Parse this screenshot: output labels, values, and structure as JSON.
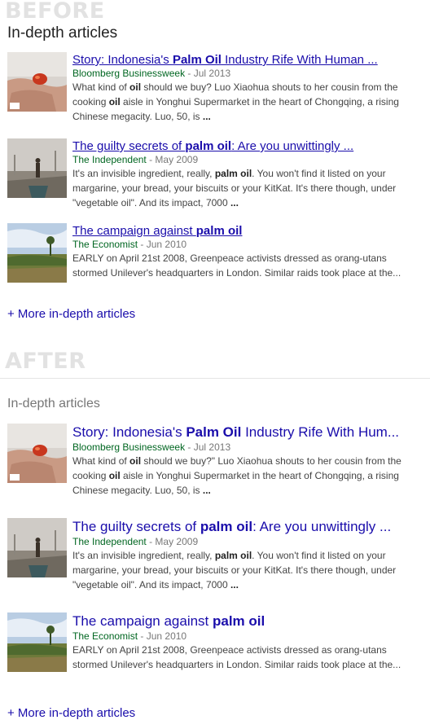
{
  "before": {
    "banner": "BEFORE",
    "header": "In-depth articles",
    "more_link": "+ More in-depth articles"
  },
  "after": {
    "banner": "AFTER",
    "header": "In-depth articles",
    "more_link": "+ More in-depth articles"
  },
  "articles": [
    {
      "title_pre": "Story: Indonesia's ",
      "title_bold": "Palm Oil",
      "title_post": " Industry Rife With Human ...",
      "title_post_after": " Industry Rife With Hum...",
      "source": "Bloomberg Businessweek",
      "date": " - Jul 2013",
      "snippet": [
        {
          "t": "What kind of "
        },
        {
          "t": "oil",
          "b": true
        },
        {
          "t": " should we buy? Luo Xiaohua shouts to her cousin from the cooking "
        },
        {
          "t": "oil",
          "b": true
        },
        {
          "t": " aisle in Yonghui Supermarket in the heart of Chongqing, a rising Chinese megacity. Luo, 50, is "
        },
        {
          "t": "...",
          "b": true
        }
      ],
      "snippet_after": [
        {
          "t": "What kind of "
        },
        {
          "t": "oil",
          "b": true
        },
        {
          "t": " should we buy?\" Luo Xiaohua shouts to her cousin from the cooking "
        },
        {
          "t": "oil",
          "b": true
        },
        {
          "t": " aisle in Yonghui Supermarket in the heart of Chongqing, a rising Chinese megacity. Luo, 50, is "
        },
        {
          "t": "...",
          "b": true
        }
      ],
      "thumb_icon": "hand-holding-palm-fruit-thumbnail"
    },
    {
      "title_pre": "The guilty secrets of ",
      "title_bold": "palm oil",
      "title_post": ": Are you unwittingly ...",
      "title_post_after": ": Are you unwittingly ...",
      "source": "The Independent",
      "date": " - May 2009",
      "snippet": [
        {
          "t": "It's an invisible ingredient, really, "
        },
        {
          "t": "palm oil",
          "b": true
        },
        {
          "t": ". You won't find it listed on your margarine, your bread, your biscuits or your KitKat. It's there though, under \"vegetable oil\". And its impact, 7000 "
        },
        {
          "t": "...",
          "b": true
        }
      ],
      "snippet_after": [
        {
          "t": "It's an invisible ingredient, really, "
        },
        {
          "t": "palm oil",
          "b": true
        },
        {
          "t": ". You won't find it listed on your margarine, your bread, your biscuits or your KitKat. It's there though, under \"vegetable oil\". And its impact, 7000 "
        },
        {
          "t": "...",
          "b": true
        }
      ],
      "thumb_icon": "misty-swamp-boat-thumbnail"
    },
    {
      "title_pre": "The campaign against ",
      "title_bold": "palm oil",
      "title_post": "",
      "title_post_after": "",
      "source": "The Economist",
      "date": " - Jun 2010",
      "snippet": [
        {
          "t": "EARLY on April 21st 2008, Greenpeace activists dressed as orang-utans stormed Unilever's headquarters in London. Similar raids took place at the..."
        }
      ],
      "snippet_after": [
        {
          "t": "EARLY on April 21st 2008, Greenpeace activists dressed as orang-utans stormed Unilever's headquarters in London. Similar raids took place at the..."
        }
      ],
      "thumb_icon": "plantation-landscape-thumbnail"
    }
  ],
  "colors": {
    "link": "#1a0dab",
    "source": "#006621",
    "date": "#777777",
    "banner": "#e2e2e2"
  }
}
